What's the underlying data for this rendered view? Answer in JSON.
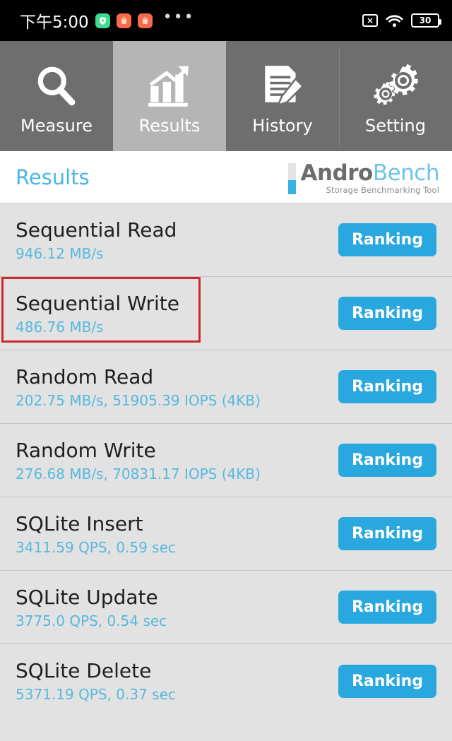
{
  "statusbar": {
    "time": "下午5:00",
    "app_icons": [
      {
        "name": "shield-app-icon",
        "color": "#3ddc91"
      },
      {
        "name": "bag-app-icon",
        "color": "#f96a4a"
      },
      {
        "name": "bag-app-icon",
        "color": "#f96a4a"
      }
    ],
    "overflow": "•••",
    "no_sim_icon": "×",
    "wifi_icon": "wifi-icon",
    "battery_level": "30"
  },
  "tabs": [
    {
      "label": "Measure",
      "icon": "magnifier-icon",
      "active": false
    },
    {
      "label": "Results",
      "icon": "bar-chart-icon",
      "active": true
    },
    {
      "label": "History",
      "icon": "document-pencil-icon",
      "active": false
    },
    {
      "label": "Setting",
      "icon": "gears-icon",
      "active": false
    }
  ],
  "header": {
    "page_title": "Results",
    "logo_main_dark": "Andro",
    "logo_main_light": "Bench",
    "logo_tagline": "Storage Benchmarking Tool"
  },
  "colors": {
    "accent_blue": "#29a8e0",
    "value_blue": "#59b8de",
    "title_blue": "#4ab6e3",
    "tabbar_bg": "#6e6e6e",
    "tab_active_bg": "#b5b5b5",
    "list_bg": "#e2e2e2",
    "highlight_red": "#cc2a2a"
  },
  "results": [
    {
      "title": "Sequential Read",
      "value": "946.12 MB/s",
      "button": "Ranking",
      "highlighted": false
    },
    {
      "title": "Sequential Write",
      "value": "486.76 MB/s",
      "button": "Ranking",
      "highlighted": true
    },
    {
      "title": "Random Read",
      "value": "202.75 MB/s, 51905.39 IOPS (4KB)",
      "button": "Ranking",
      "highlighted": false
    },
    {
      "title": "Random Write",
      "value": "276.68 MB/s, 70831.17 IOPS (4KB)",
      "button": "Ranking",
      "highlighted": false
    },
    {
      "title": "SQLite Insert",
      "value": "3411.59 QPS, 0.59 sec",
      "button": "Ranking",
      "highlighted": false
    },
    {
      "title": "SQLite Update",
      "value": "3775.0 QPS, 0.54 sec",
      "button": "Ranking",
      "highlighted": false
    },
    {
      "title": "SQLite Delete",
      "value": "5371.19 QPS, 0.37 sec",
      "button": "Ranking",
      "highlighted": false
    }
  ]
}
